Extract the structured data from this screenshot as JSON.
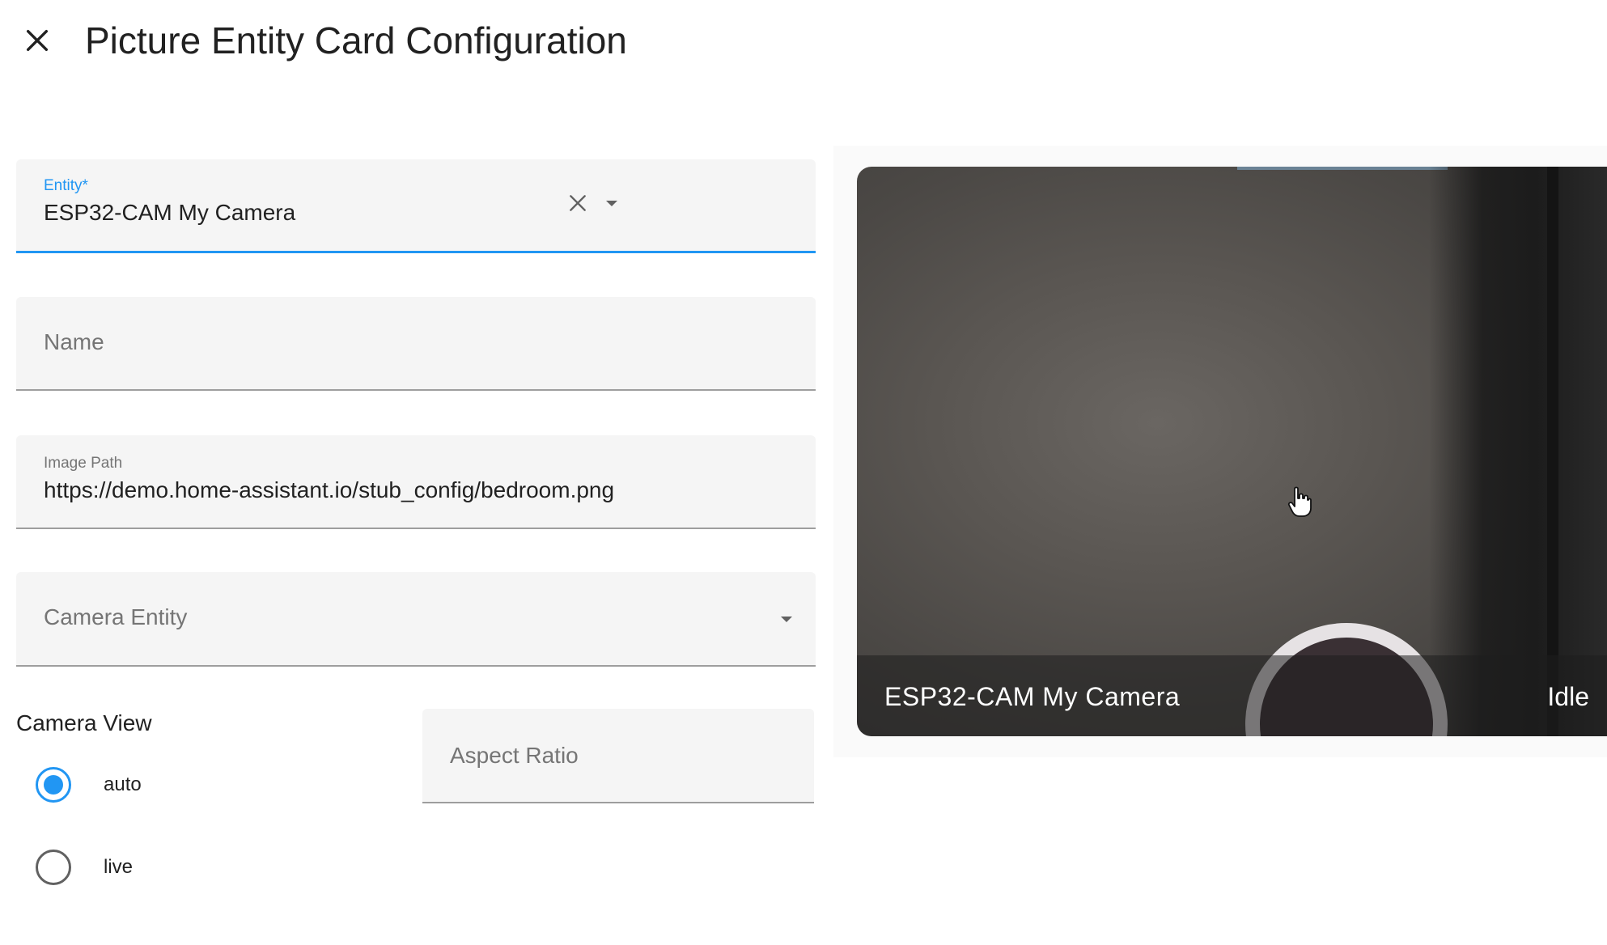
{
  "header": {
    "title": "Picture Entity Card Configuration",
    "close_icon": "close-icon"
  },
  "form": {
    "entity": {
      "label": "Entity*",
      "value": "ESP32-CAM My Camera",
      "clear_icon": "clear-icon",
      "dropdown_icon": "chevron-down-icon"
    },
    "name": {
      "label": "Name",
      "value": ""
    },
    "image_path": {
      "label": "Image Path",
      "value": "https://demo.home-assistant.io/stub_config/bedroom.png"
    },
    "camera_entity": {
      "label": "Camera Entity",
      "value": "",
      "dropdown_icon": "chevron-down-icon"
    },
    "camera_view": {
      "label": "Camera View",
      "options": [
        {
          "label": "auto",
          "checked": true
        },
        {
          "label": "live",
          "checked": false
        }
      ]
    },
    "aspect_ratio": {
      "label": "Aspect Ratio",
      "value": ""
    }
  },
  "preview": {
    "name": "ESP32-CAM My Camera",
    "state": "Idle"
  },
  "colors": {
    "accent": "#2196f3",
    "field_bg": "#f5f5f5"
  }
}
